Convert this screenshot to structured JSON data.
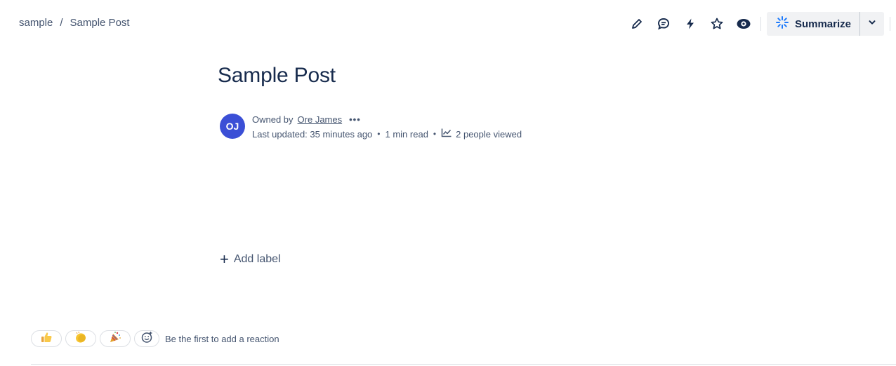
{
  "breadcrumb": {
    "space": "sample",
    "separator": "/",
    "page": "Sample Post"
  },
  "toolbar": {
    "icons": [
      "edit-icon",
      "comment-icon",
      "lightning-icon",
      "star-icon",
      "eye-icon"
    ],
    "summarize_label": "Summarize",
    "accent_color": "#1d7afc"
  },
  "page": {
    "title": "Sample Post"
  },
  "byline": {
    "avatar_initials": "OJ",
    "avatar_color": "#3b4fd6",
    "owned_by_label": "Owned by",
    "owner_name": "Ore James",
    "more_label": "•••",
    "last_updated": "Last updated: 35 minutes ago",
    "read_time": "1 min read",
    "views": "2 people viewed",
    "separator": "•"
  },
  "labels": {
    "add_label": "Add label",
    "plus": "+"
  },
  "reactions": {
    "items": [
      {
        "name": "thumbs-up-emoji",
        "glyph": "👍"
      },
      {
        "name": "clapping-hands-emoji",
        "glyph": "👏"
      },
      {
        "name": "party-popper-emoji",
        "glyph": "🎉"
      }
    ],
    "hint": "Be the first to add a reaction"
  }
}
